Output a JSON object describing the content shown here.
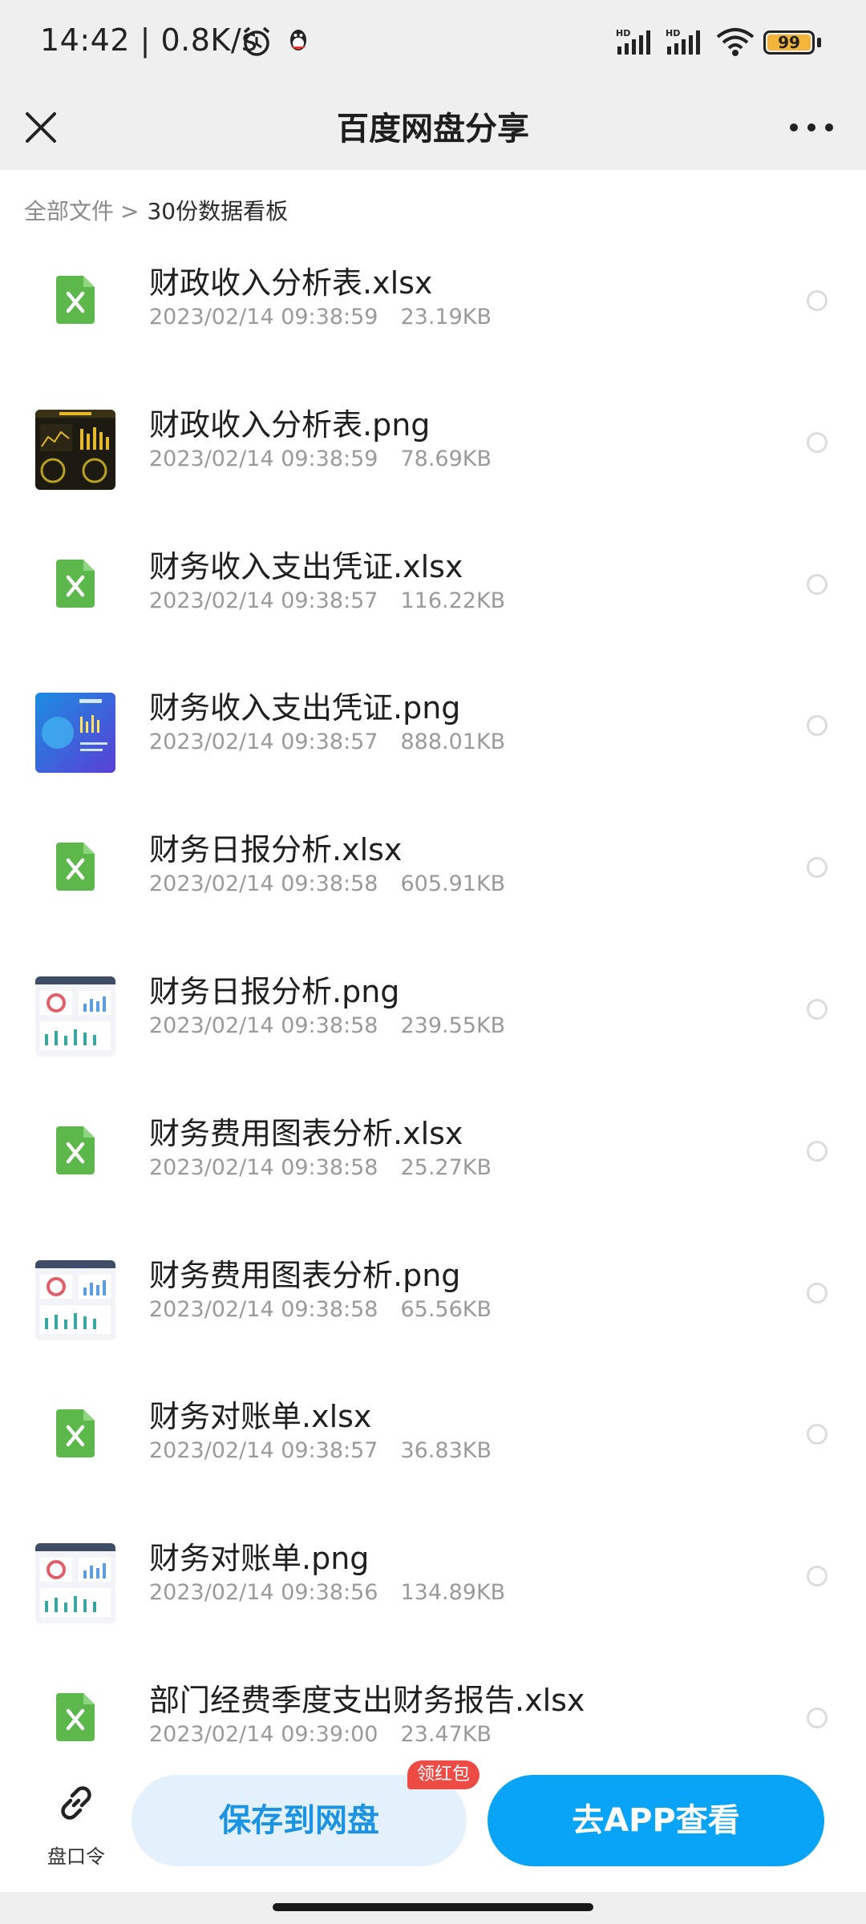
{
  "status": {
    "time_speed": "14:42 | 0.8K/s",
    "battery": "99",
    "signal1_label": "HD",
    "signal2_label": "HD"
  },
  "nav": {
    "title": "百度网盘分享"
  },
  "breadcrumb": {
    "root": "全部文件",
    "separator": ">",
    "current": "30份数据看板"
  },
  "files": [
    {
      "name": "财政收入分析表.xlsx",
      "date": "2023/02/14 09:38:59",
      "size": "23.19KB",
      "type": "xlsx"
    },
    {
      "name": "财政收入分析表.png",
      "date": "2023/02/14 09:38:59",
      "size": "78.69KB",
      "type": "png-dark"
    },
    {
      "name": "财务收入支出凭证.xlsx",
      "date": "2023/02/14 09:38:57",
      "size": "116.22KB",
      "type": "xlsx"
    },
    {
      "name": "财务收入支出凭证.png",
      "date": "2023/02/14 09:38:57",
      "size": "888.01KB",
      "type": "png-blue"
    },
    {
      "name": "财务日报分析.xlsx",
      "date": "2023/02/14 09:38:58",
      "size": "605.91KB",
      "type": "xlsx"
    },
    {
      "name": "财务日报分析.png",
      "date": "2023/02/14 09:38:58",
      "size": "239.55KB",
      "type": "png-light"
    },
    {
      "name": "财务费用图表分析.xlsx",
      "date": "2023/02/14 09:38:58",
      "size": "25.27KB",
      "type": "xlsx"
    },
    {
      "name": "财务费用图表分析.png",
      "date": "2023/02/14 09:38:58",
      "size": "65.56KB",
      "type": "png-light"
    },
    {
      "name": "财务对账单.xlsx",
      "date": "2023/02/14 09:38:57",
      "size": "36.83KB",
      "type": "xlsx"
    },
    {
      "name": "财务对账单.png",
      "date": "2023/02/14 09:38:56",
      "size": "134.89KB",
      "type": "png-light"
    },
    {
      "name": "部门经费季度支出财务报告.xlsx",
      "date": "2023/02/14 09:39:00",
      "size": "23.47KB",
      "type": "xlsx"
    }
  ],
  "bottom": {
    "code_label": "盘口令",
    "save_label": "保存到网盘",
    "badge": "领红包",
    "app_label": "去APP查看"
  },
  "colors": {
    "accent": "#0aa4f6",
    "save_bg": "#e3f1fd",
    "badge": "#ef4b45",
    "xls_green": "#5cb84a"
  }
}
